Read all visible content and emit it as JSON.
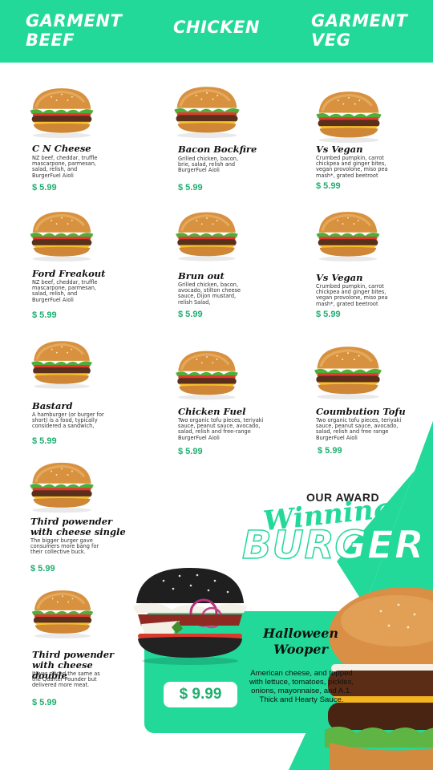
{
  "categories": [
    {
      "line1": "GARMENT",
      "line2": "BEEF"
    },
    {
      "line1": "CHICKEN",
      "line2": ""
    },
    {
      "line1": "GARMENT",
      "line2": "VEG"
    }
  ],
  "items": [
    {
      "name": "C N Cheese",
      "desc": "NZ beef, cheddar, truffle mascarpone, parmesan, salad, relish, and BurgerFuel Aioli",
      "price": "$ 5.99"
    },
    {
      "name": "Bacon Bockfire",
      "desc": "Grilled chicken, bacon, brie, salad, relish and BurgerFuel Aioli",
      "price": "$ 5.99"
    },
    {
      "name": "Vs Vegan",
      "desc": "Crumbed pumpkin, carrot chickpea and ginger bites, vegan provolone, miso pea mash*, grated beetroot",
      "price": "$ 5.99"
    },
    {
      "name": "Ford Freakout",
      "desc": "NZ beef, cheddar, truffle mascarpone, parmesan, salad, relish, and BurgerFuel Aioli",
      "price": "$ 5.99"
    },
    {
      "name": "Brun out",
      "desc": "Grilled chicken, bacon, avocado, stilton cheese sauce, Dijon mustard, relish Salad,",
      "price": "$ 5.99"
    },
    {
      "name": "Vs Vegan",
      "desc": "Crumbed pumpkin, carrot chickpea and ginger bites, vegan provolone, miso pea mash*, grated beetroot",
      "price": "$ 5.99"
    },
    {
      "name": "Bastard",
      "desc": "A hamburger (or burger for short) is a food, typically considered a sandwich,",
      "price": "$ 5.99"
    },
    {
      "name": "Chicken Fuel",
      "desc": "Two organic tofu pieces, teriyaki sauce, peanut sauce, avocado, salad, relish and free-range BurgerFuel Aioli",
      "price": "$ 5.99"
    },
    {
      "name": "Coumbution  Tofu",
      "desc": "Two organic tofu pieces, teriyaki sauce, peanut sauce, avocado, salad, relish and free range BurgerFuel Aioli",
      "price": "$ 5.99"
    },
    {
      "name": "Third powender with cheese single",
      "desc": "The bigger burger gave consumers more bang for their collective buck.",
      "price": "$ 5.99"
    },
    {
      "name": "Third powender with cheese double",
      "desc": "It was priced the same as the Quarter Pounder but delivered more meat.",
      "price": "$ 5.99"
    }
  ],
  "award": {
    "line1": "OUR AWARD",
    "line2": "Winning",
    "line3": "BURGER"
  },
  "featured": {
    "name_line1": "Halloween",
    "name_line2": "Wooper",
    "desc": "American cheese, and topped with lettuce, tomatoes, pickles, onions, mayonnaise, and A.1. Thick and Hearty Sauce.",
    "price": "$ 9.99"
  },
  "colors": {
    "accent": "#22d99a",
    "price": "#1fae6f"
  },
  "icons": [
    "burger-image",
    "black-burger-image",
    "big-burger-image"
  ]
}
